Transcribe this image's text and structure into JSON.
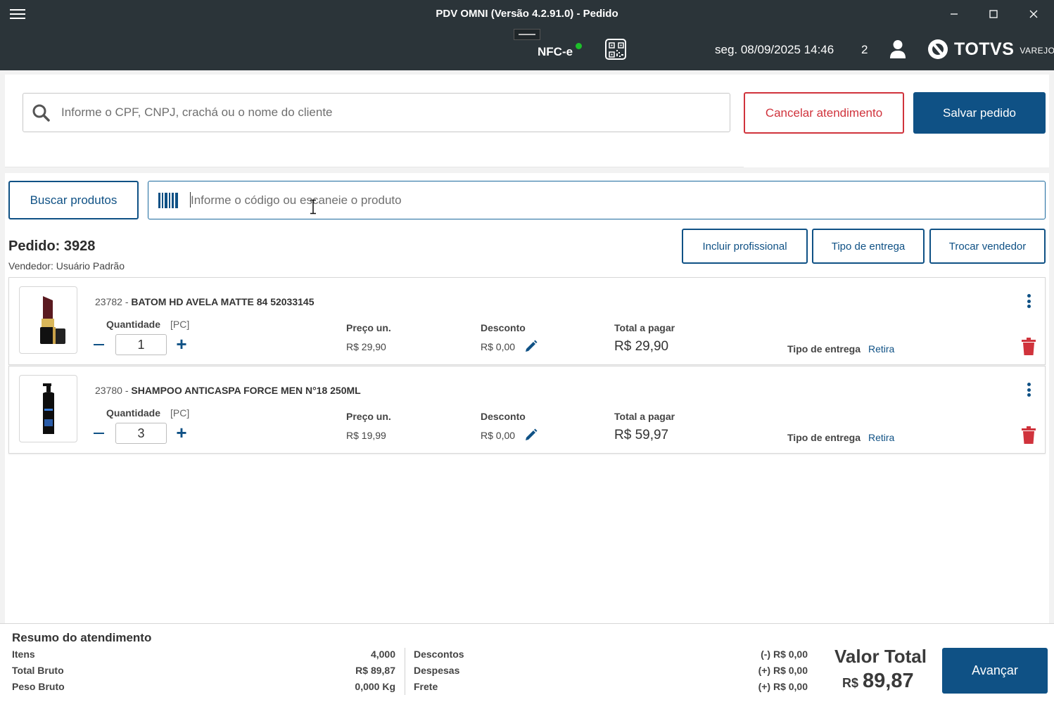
{
  "window": {
    "title": "PDV OMNI (Versão 4.2.91.0) - Pedido"
  },
  "header": {
    "nfce_label": "NFC-e",
    "datetime": "seg. 08/09/2025 14:46",
    "count": "2",
    "logo_text": "TOTVS",
    "logo_sub": "VAREJO"
  },
  "client": {
    "search_placeholder": "Informe o CPF, CNPJ, crachá ou o nome do cliente",
    "cancel_label": "Cancelar atendimento",
    "save_label": "Salvar pedido"
  },
  "product_search": {
    "button_label": "Buscar produtos",
    "placeholder": "Informe o código ou escaneie o produto"
  },
  "order": {
    "title": "Pedido: 3928",
    "seller": "Vendedor: Usuário Padrão",
    "actions": {
      "include_professional": "Incluir profissional",
      "delivery_type": "Tipo de entrega",
      "change_seller": "Trocar vendedor"
    }
  },
  "labels": {
    "quantity": "Quantidade",
    "unit": "[PC]",
    "unit_price": "Preço un.",
    "discount": "Desconto",
    "total_to_pay": "Total a pagar",
    "delivery_type": "Tipo de entrega"
  },
  "items": [
    {
      "code": "23782 - ",
      "name": "BATOM HD AVELA MATTE 84 52033145",
      "quantity": "1",
      "unit_price": "R$ 29,90",
      "discount": "R$ 0,00",
      "total": "R$ 29,90",
      "delivery": "Retira"
    },
    {
      "code": "23780 - ",
      "name": "SHAMPOO ANTICASPA FORCE MEN N°18 250ML",
      "quantity": "3",
      "unit_price": "R$ 19,99",
      "discount": "R$ 0,00",
      "total": "R$ 59,97",
      "delivery": "Retira"
    }
  ],
  "summary": {
    "title": "Resumo do atendimento",
    "items_label": "Itens",
    "items_value": "4,000",
    "gross_total_label": "Total Bruto",
    "gross_total_value": "R$ 89,87",
    "gross_weight_label": "Peso Bruto",
    "gross_weight_value": "0,000 Kg",
    "discounts_label": "Descontos",
    "discounts_value": "(-) R$ 0,00",
    "expenses_label": "Despesas",
    "expenses_value": "(+) R$ 0,00",
    "freight_label": "Frete",
    "freight_value": "(+) R$ 0,00",
    "total_label": "Valor Total",
    "total_currency": "R$",
    "total_value": "89,87",
    "next_label": "Avançar"
  },
  "colors": {
    "primary": "#0f5185",
    "danger": "#d0333c",
    "header_bg": "#2b3439",
    "status_online": "#1dbf2a"
  },
  "icons": [
    "menu-icon",
    "minimize-icon",
    "maximize-icon",
    "close-icon",
    "printer-icon",
    "qr-code-icon",
    "user-icon",
    "totvs-logo-icon",
    "search-icon",
    "barcode-icon",
    "minus-icon",
    "plus-icon",
    "pencil-icon",
    "kebab-menu-icon",
    "trash-icon"
  ]
}
